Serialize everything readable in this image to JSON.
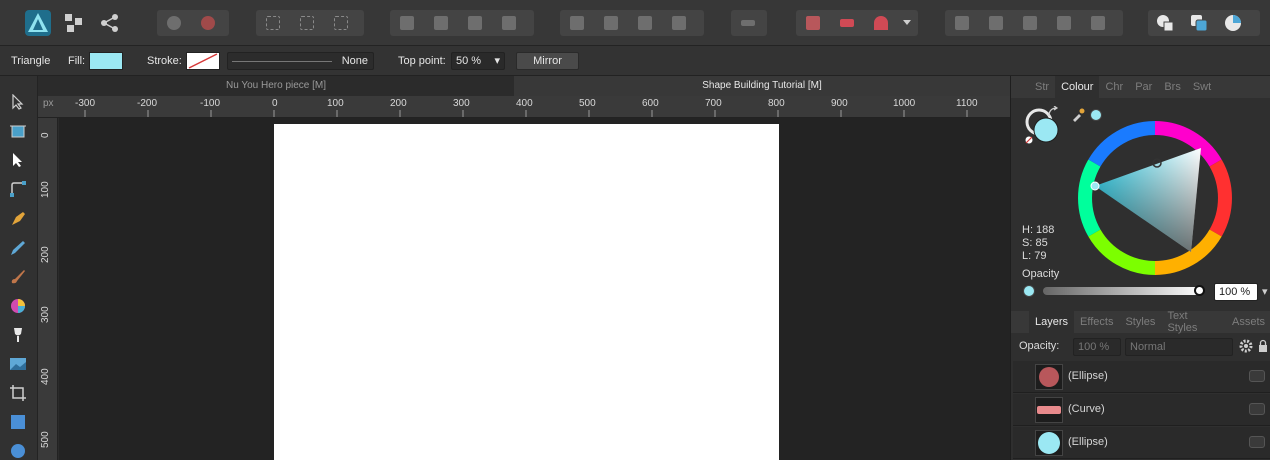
{
  "colors": {
    "fill": "#9be8f3",
    "selected_colour": "#9be8f3",
    "accent_red": "#b8575b",
    "curve_pink": "#e88a8c"
  },
  "toolbar": {
    "persona_icons": [
      "designer-persona-icon",
      "pixel-persona-icon",
      "export-persona-icon"
    ]
  },
  "context": {
    "tool_name": "Triangle",
    "fill_label": "Fill:",
    "stroke_label": "Stroke:",
    "stroke_value": "None",
    "top_point_label": "Top point:",
    "top_point_value": "50 %",
    "mirror_label": "Mirror"
  },
  "documents": {
    "tabs": [
      {
        "label": "Nu You Hero piece [M]"
      },
      {
        "label": "Shape Building Tutorial [M]"
      }
    ]
  },
  "ruler": {
    "unit": "px",
    "h_labels": [
      "-300",
      "-200",
      "-100",
      "0",
      "100",
      "200",
      "300",
      "400",
      "500",
      "600",
      "700",
      "800",
      "900",
      "1000",
      "1100"
    ],
    "v_labels": [
      "0",
      "100",
      "200",
      "300",
      "400",
      "500"
    ]
  },
  "colour_panel": {
    "tabs": [
      "Str",
      "Colour",
      "Chr",
      "Par",
      "Brs",
      "Swt"
    ],
    "active_tab": "Colour",
    "h": "H: 188",
    "s": "S: 85",
    "l": "L: 79",
    "opacity_label": "Opacity",
    "opacity_value": "100 %"
  },
  "layers_panel": {
    "tabs": [
      "Layers",
      "Effects",
      "Styles",
      "Text Styles",
      "Assets"
    ],
    "active_tab": "Layers",
    "opacity_label": "Opacity:",
    "opacity_value": "100 %",
    "blend_mode": "Normal",
    "layers": [
      {
        "name": "(Ellipse)"
      },
      {
        "name": "(Curve)"
      },
      {
        "name": "(Ellipse)"
      }
    ]
  }
}
